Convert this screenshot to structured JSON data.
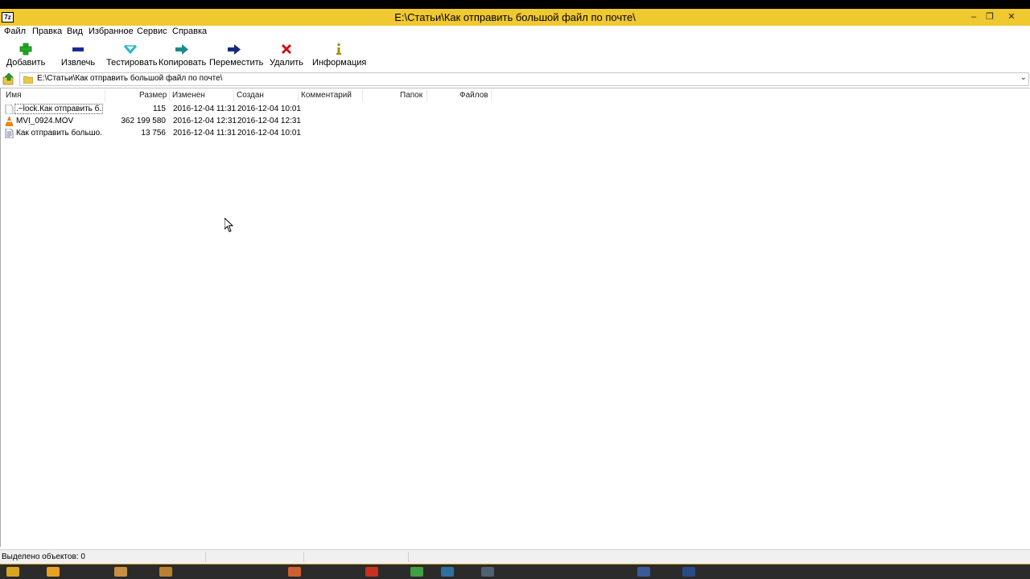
{
  "window": {
    "title": "E:\\Статьи\\Как отправить большой файл по почте\\",
    "app_icon": "7z",
    "minimize_glyph": "–",
    "maximize_glyph": "❐",
    "close_glyph": "✕"
  },
  "menu": [
    "Файл",
    "Правка",
    "Вид",
    "Избранное",
    "Сервис",
    "Справка"
  ],
  "toolbar": [
    {
      "label": "Добавить",
      "icon": "add-icon",
      "color": "#22aa22"
    },
    {
      "label": "Извлечь",
      "icon": "extract-icon",
      "color": "#1a2a9a"
    },
    {
      "label": "Тестировать",
      "icon": "test-icon",
      "color": "#2ab8c8"
    },
    {
      "label": "Копировать",
      "icon": "copy-icon",
      "color": "#1a8a8a"
    },
    {
      "label": "Переместить",
      "icon": "move-icon",
      "color": "#1a2a7a"
    },
    {
      "label": "Удалить",
      "icon": "delete-icon",
      "color": "#d01010"
    },
    {
      "label": "Информация",
      "icon": "info-icon",
      "color": "#a09000"
    }
  ],
  "address": {
    "path": "E:\\Статьи\\Как отправить большой файл по почте\\",
    "dropdown_glyph": "⌄"
  },
  "columns": [
    "Имя",
    "Размер",
    "Изменен",
    "Создан",
    "Комментарий",
    "Папок",
    "Файлов"
  ],
  "files": [
    {
      "name": ".~lock.Как отправить б...",
      "size": "115",
      "modified": "2016-12-04 11:31",
      "created": "2016-12-04 10:01",
      "icon": "file-icon"
    },
    {
      "name": "MVI_0924.MOV",
      "size": "362 199 580",
      "modified": "2016-12-04 12:31",
      "created": "2016-12-04 12:31",
      "icon": "vlc-icon"
    },
    {
      "name": "Как отправить большо...",
      "size": "13 756",
      "modified": "2016-12-04 11:31",
      "created": "2016-12-04 10:01",
      "icon": "document-icon"
    }
  ],
  "status": {
    "selected": "Выделено объектов: 0"
  },
  "colors": {
    "titlebar": "#f0c830",
    "taskbar": "#2b2b2b"
  }
}
